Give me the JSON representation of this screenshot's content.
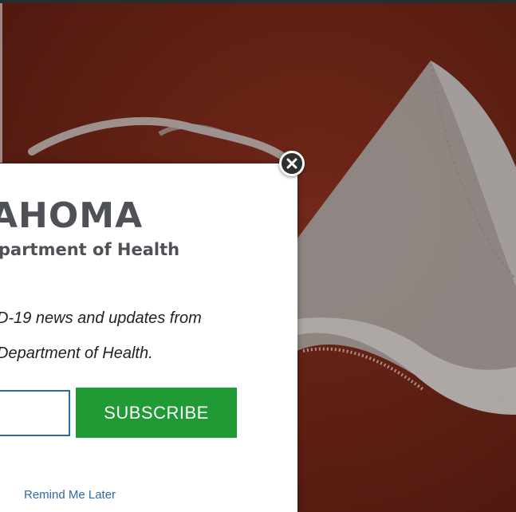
{
  "modal": {
    "logo": {
      "line1": "AHOMA",
      "line2": "partment of Health"
    },
    "intro_lines": [
      "D-19 news and updates from",
      "Department of Health."
    ],
    "email_input": {
      "value": "",
      "placeholder": ""
    },
    "subscribe_label": "SUBSCRIBE",
    "remind_label": "Remind Me Later",
    "close_icon": "close-icon"
  },
  "colors": {
    "background": "#6a2416",
    "subscribe_button": "#1f9a35",
    "link": "#2b6aa8",
    "logo_text": "#4e5256"
  }
}
